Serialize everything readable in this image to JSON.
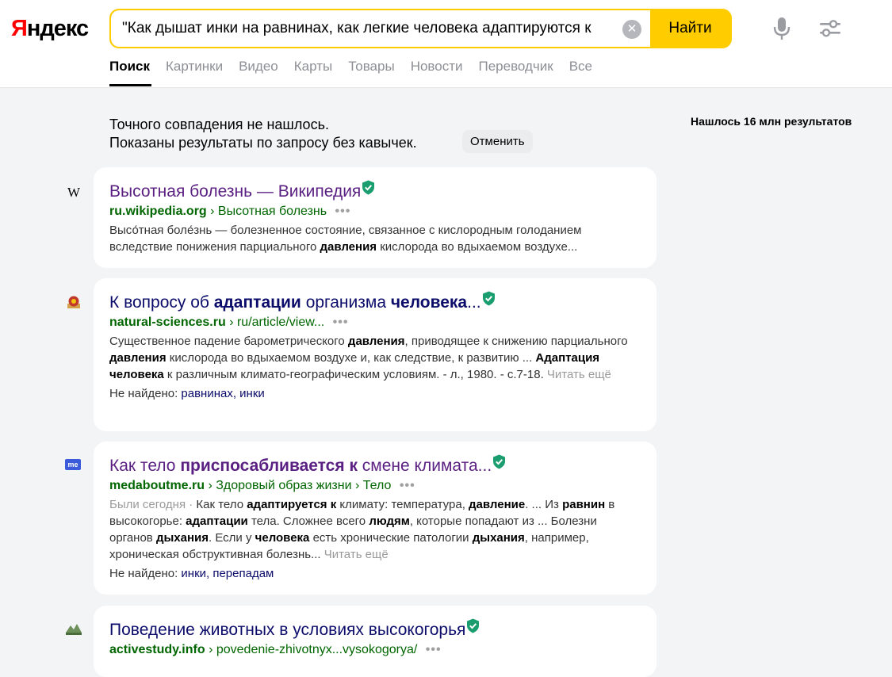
{
  "header": {
    "logo_first": "Я",
    "logo_rest": "ндекс",
    "query": "\"Как дышат инки на равнинах, как легкие человека адаптируются к",
    "search_button": "Найти",
    "tabs": [
      "Поиск",
      "Картинки",
      "Видео",
      "Карты",
      "Товары",
      "Новости",
      "Переводчик",
      "Все"
    ]
  },
  "notice": {
    "line1": "Точного совпадения не нашлось.",
    "line2": "Показаны результаты по запросу без кавычек.",
    "cancel": "Отменить"
  },
  "results_count": "Нашлось 16 млн результатов",
  "icons": {
    "clear": "clear-icon",
    "mic": "microphone-icon",
    "settings": "sliders-icon",
    "verified": "shield-check-icon"
  },
  "colors": {
    "accent": "#ffcc00",
    "link": "#5a1f82",
    "link_visited": "#0c0c6b",
    "url": "#006600",
    "verified": "#1a9e6f"
  },
  "results": [
    {
      "favicon": "W",
      "title": "Высотная болезнь — Википедия",
      "host": "ru.wikipedia.org",
      "path": "› Высотная болезнь",
      "dots": "•••",
      "snippet_a": "Высо́тная боле́знь — болезненное состояние, связанное с кислородным голоданием вследствие понижения парциального ",
      "snippet_b": "давления",
      "snippet_c": " кислорода во вдыхаемом воздухе..."
    },
    {
      "title_a": "К вопросу об ",
      "title_b": "адаптации",
      "title_c": " организма ",
      "title_d": "человека",
      "title_e": "...",
      "host": "natural-sciences.ru",
      "path": "› ru/article/view...",
      "dots": "•••",
      "s1": "Существенное падение барометрического ",
      "s2": "давления",
      "s3": ", приводящее к снижению парциального ",
      "s4": "давления",
      "s5": " кислорода во вдыхаемом воздухе и, как следствие, к развитию ... ",
      "s6": "Адаптация человека",
      "s7": " к различным климато-географическим условиям. - л., 1980. - с.7-18. ",
      "more": "Читать ещё",
      "nf_label": "Не найдено: ",
      "nf_words": "равнинах, инки"
    },
    {
      "favicon": "me",
      "title_a": "Как тело ",
      "title_b": "приспосабливается к",
      "title_c": " смене климата...",
      "host": "medaboutme.ru",
      "path": "› Здоровый образ жизни › Тело",
      "dots": "•••",
      "s0": "Были сегодня · ",
      "s1": "Как тело ",
      "s2": "адаптируется к",
      "s3": " климату: температура, ",
      "s4": "давление",
      "s5": ". ... Из ",
      "s6": "равнин",
      "s7": " в высокогорье: ",
      "s8": "адаптации",
      "s9": " тела. Сложнее всего ",
      "s10": "людям",
      "s11": ", которые попадают из ... Болезни органов ",
      "s12": "дыхания",
      "s13": ". Если у ",
      "s14": "человека",
      "s15": " есть хронические патологии ",
      "s16": "дыхания",
      "s17": ", например, хроническая обструктивная болезнь...",
      "more": " Читать ещё",
      "nf_label": "Не найдено: ",
      "nf_words": "инки, перепадам"
    },
    {
      "title": "Поведение животных в условиях высокогорья",
      "host": "activestudy.info",
      "path": "› povedenie-zhivotnyx...vysokogorya/",
      "dots": "•••"
    }
  ]
}
